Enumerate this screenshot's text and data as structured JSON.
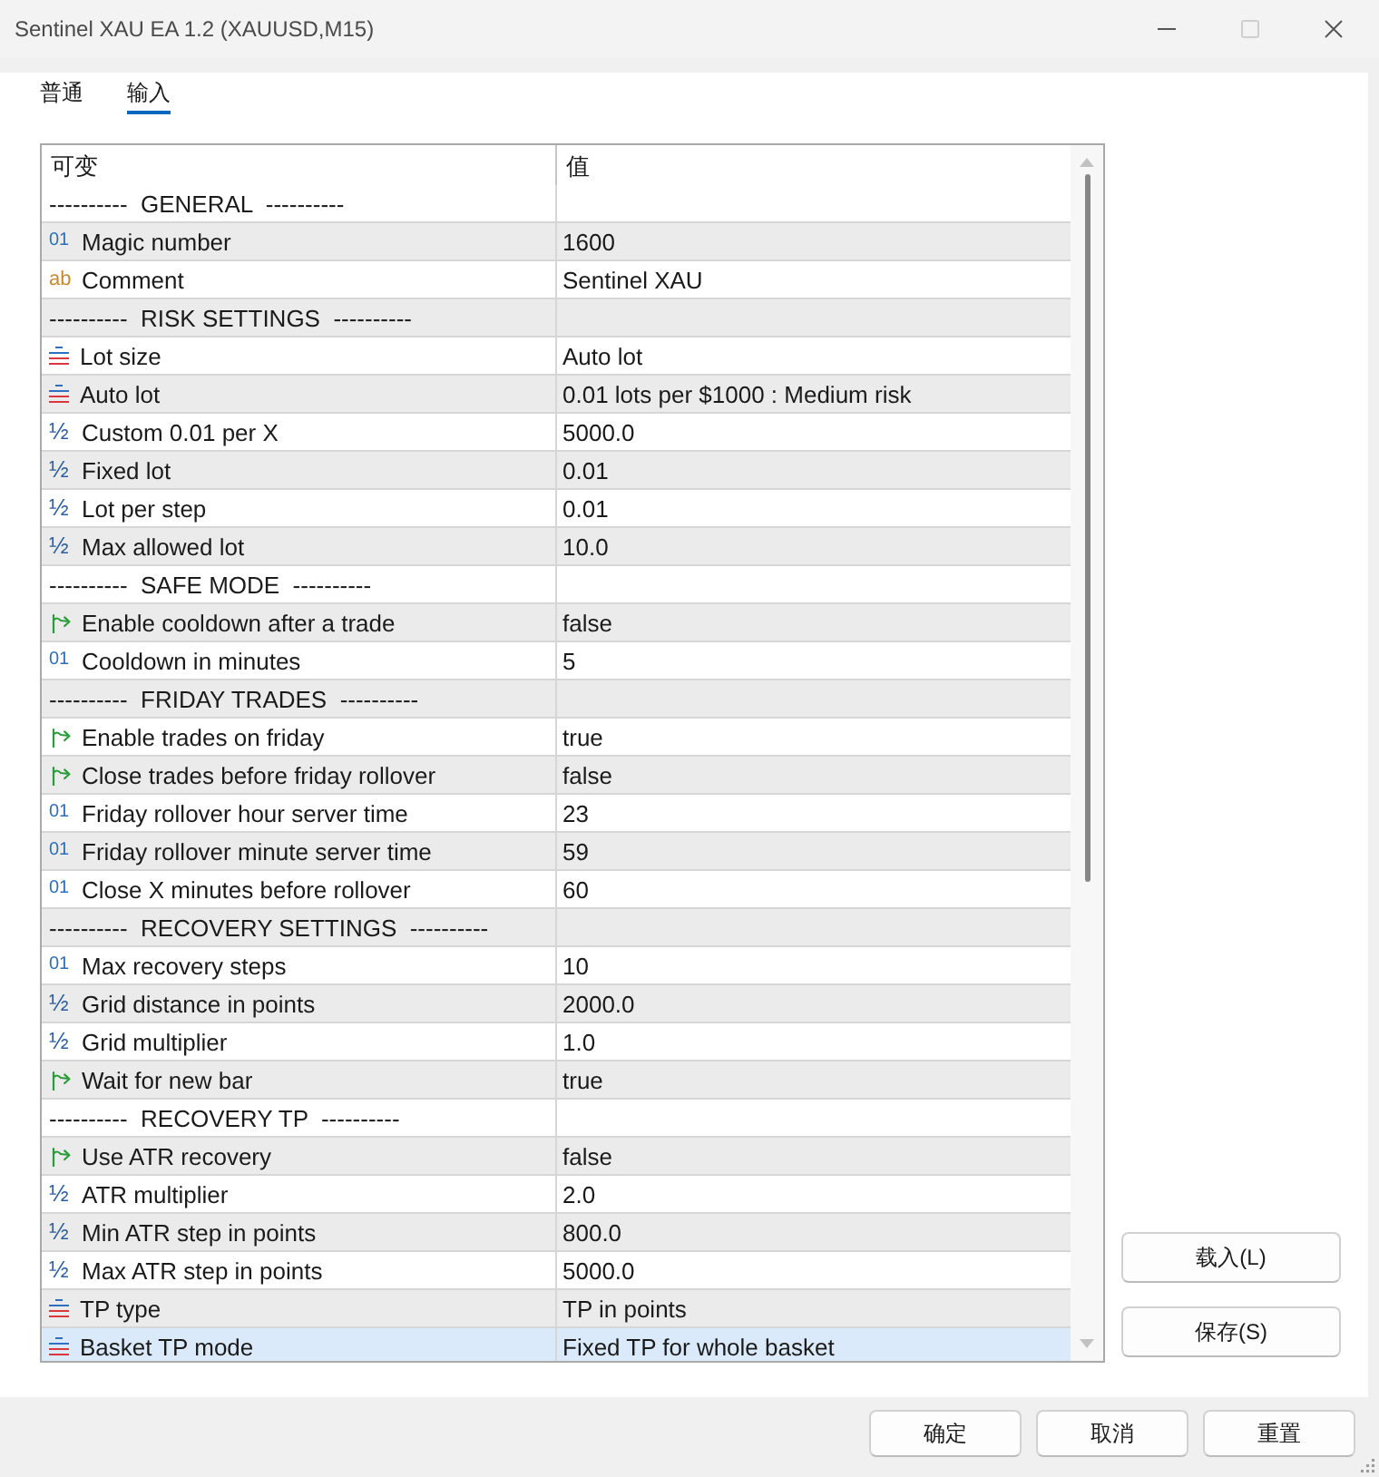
{
  "window": {
    "title": "Sentinel XAU EA 1.2 (XAUUSD,M15)",
    "maximize_disabled": true
  },
  "tabs": [
    {
      "label": "普通",
      "selected": false
    },
    {
      "label": "输入",
      "selected": true
    }
  ],
  "table": {
    "columns": [
      "可变",
      "值"
    ],
    "rows": [
      {
        "kind": "section",
        "name": "----------  GENERAL  ----------",
        "selected": false
      },
      {
        "kind": "int",
        "icon": "01",
        "name": "Magic number",
        "value": "1600",
        "selected": false
      },
      {
        "kind": "string",
        "icon": "ab",
        "name": "Comment",
        "value": "Sentinel XAU",
        "selected": false
      },
      {
        "kind": "section",
        "name": "----------  RISK SETTINGS  ----------",
        "selected": false
      },
      {
        "kind": "enum",
        "name": "Lot size",
        "value": "Auto lot",
        "selected": false
      },
      {
        "kind": "enum",
        "name": "Auto lot",
        "value": "0.01 lots per $1000 : Medium risk",
        "selected": false
      },
      {
        "kind": "double",
        "icon": "½",
        "name": "Custom 0.01 per X",
        "value": "5000.0",
        "selected": false
      },
      {
        "kind": "double",
        "icon": "½",
        "name": "Fixed lot",
        "value": "0.01",
        "selected": false
      },
      {
        "kind": "double",
        "icon": "½",
        "name": "Lot per step",
        "value": "0.01",
        "selected": false
      },
      {
        "kind": "double",
        "icon": "½",
        "name": "Max allowed lot",
        "value": "10.0",
        "selected": false
      },
      {
        "kind": "section",
        "name": "----------  SAFE MODE  ----------",
        "selected": false
      },
      {
        "kind": "bool",
        "name": "Enable cooldown after a trade",
        "value": "false",
        "selected": false
      },
      {
        "kind": "int",
        "icon": "01",
        "name": "Cooldown in minutes",
        "value": "5",
        "selected": false
      },
      {
        "kind": "section",
        "name": "----------  FRIDAY TRADES  ----------",
        "selected": false
      },
      {
        "kind": "bool",
        "name": "Enable trades on friday",
        "value": "true",
        "selected": false
      },
      {
        "kind": "bool",
        "name": "Close trades before friday rollover",
        "value": "false",
        "selected": false
      },
      {
        "kind": "int",
        "icon": "01",
        "name": "Friday rollover hour server time",
        "value": "23",
        "selected": false
      },
      {
        "kind": "int",
        "icon": "01",
        "name": "Friday rollover minute server time",
        "value": "59",
        "selected": false
      },
      {
        "kind": "int",
        "icon": "01",
        "name": "Close X minutes before rollover",
        "value": "60",
        "selected": false
      },
      {
        "kind": "section",
        "name": "----------  RECOVERY SETTINGS  ----------",
        "selected": false
      },
      {
        "kind": "int",
        "icon": "01",
        "name": "Max recovery steps",
        "value": "10",
        "selected": false
      },
      {
        "kind": "double",
        "icon": "½",
        "name": "Grid distance in points",
        "value": "2000.0",
        "selected": false
      },
      {
        "kind": "double",
        "icon": "½",
        "name": "Grid multiplier",
        "value": "1.0",
        "selected": false
      },
      {
        "kind": "bool",
        "name": "Wait for new bar",
        "value": "true",
        "selected": false
      },
      {
        "kind": "section",
        "name": "----------  RECOVERY TP  ----------",
        "selected": false
      },
      {
        "kind": "bool",
        "name": "Use ATR recovery",
        "value": "false",
        "selected": false
      },
      {
        "kind": "double",
        "icon": "½",
        "name": "ATR multiplier",
        "value": "2.0",
        "selected": false
      },
      {
        "kind": "double",
        "icon": "½",
        "name": "Min ATR step in points",
        "value": "800.0",
        "selected": false
      },
      {
        "kind": "double",
        "icon": "½",
        "name": "Max ATR step in points",
        "value": "5000.0",
        "selected": false
      },
      {
        "kind": "enum",
        "name": "TP type",
        "value": "TP in points",
        "selected": false
      },
      {
        "kind": "enum",
        "name": "Basket TP mode",
        "value": "Fixed TP for whole basket",
        "selected": true
      }
    ]
  },
  "side_buttons": [
    "载入(L)",
    "保存(S)"
  ],
  "buttons": [
    "确定",
    "取消",
    "重置"
  ]
}
